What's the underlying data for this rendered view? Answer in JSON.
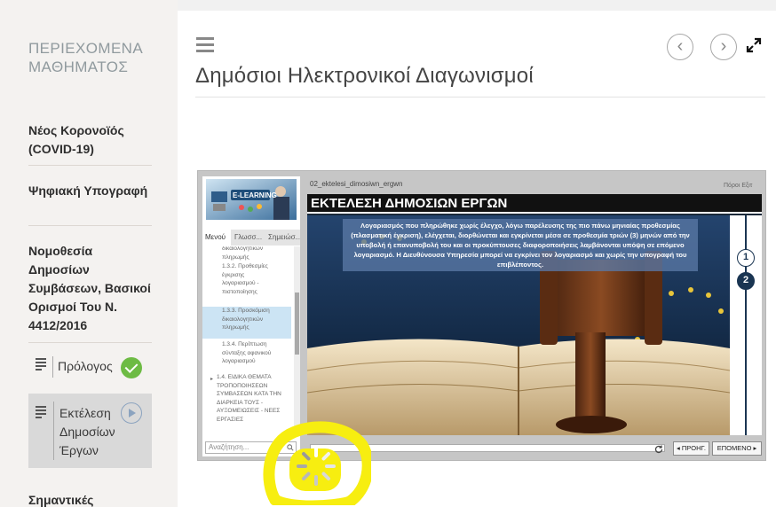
{
  "sidebar": {
    "title": "ΠΕΡΙΕΧΟΜΕΝΑ ΜΑΘΗΜΑΤΟΣ",
    "items": [
      "Νέος Κορονοϊός (COVID-19)",
      "Ψηφιακή Υπογραφή",
      "Νομοθεσία Δημοσίων Συμβάσεων, Βασικοί Ορισμοί Του Ν. 4412/2016"
    ],
    "lessons": [
      {
        "label": "Πρόλογος",
        "status": "completed"
      },
      {
        "label": "Εκτέλεση Δημοσίων Έργων",
        "status": "current"
      }
    ],
    "next_item": "Σημαντικές"
  },
  "main": {
    "title": "Δημόσιοι Ηλεκτρονικοί Διαγωνισμοί"
  },
  "player": {
    "tabs": [
      "Μενού",
      "Γλωσσ...",
      "Σημειώσ..."
    ],
    "outline": [
      "δικαιολογητικών πληρωμής",
      "1.3.2. Προθεσμίες έγκρισης λογαριασμού - πιστοποίησης",
      "1.3.3. Προσκόμιση δικαιολογητικών πληρωμής",
      "1.3.4. Περίπτωση σύνταξης αφανικού λογαριασμού",
      "1.4. ΕΙΔΙΚΑ ΘΕΜΑΤΑ ΤΡΟΠΟΠΟΙΗΣΕΩΝ ΣΥΜΒΑΣΕΩΝ ΚΑΤΑ ΤΗΝ ΔΙΑΡΚΕΙΑ ΤΟΥΣ - ΑΥΞΟΜΕΙΩΣΕΙΣ - ΝΕΕΣ ΕΡΓΑΣΙΕΣ"
    ],
    "search_placeholder": "Αναζήτηση...",
    "slide_file": "02_ektelesi_dimosiwn_ergwn",
    "links": "Πόροι   Εξιτ",
    "slide_title": "ΕΚΤΕΛΕΣΗ ΔΗΜΟΣΙΩΝ ΕΡΓΩΝ",
    "slide_text": "Λογαριασμός που πληρώθηκε χωρίς έλεγχο, λόγω παρέλευσης της πιο πάνω μηνιαίας προθεσμίας (πλασματική έγκριση), ελέγχεται, διορθώνεται και εγκρίνεται μέσα σε προθεσμία τριών (3) μηνών από την υποβολή ή επανυποβολή του και οι προκύπτουσες διαφοροποιήσεις λαμβάνονται υπόψη σε επόμενο λογαριασμό. Η Διευθύνουσα Υπηρεσία μπορεί να εγκρίνει τον λογαριασμό και χωρίς την υπογραφή του επιβλέποντος.",
    "steps": [
      "1",
      "2"
    ],
    "current_step": 2,
    "prev_label": "◂ ΠΡΟΗΓ.",
    "next_label": "ΕΠΟΜΕΝΟ ▸"
  },
  "colors": {
    "accent_check": "#6dbb44",
    "step_navy": "#1a3552",
    "highlight": "#f7ee10"
  }
}
